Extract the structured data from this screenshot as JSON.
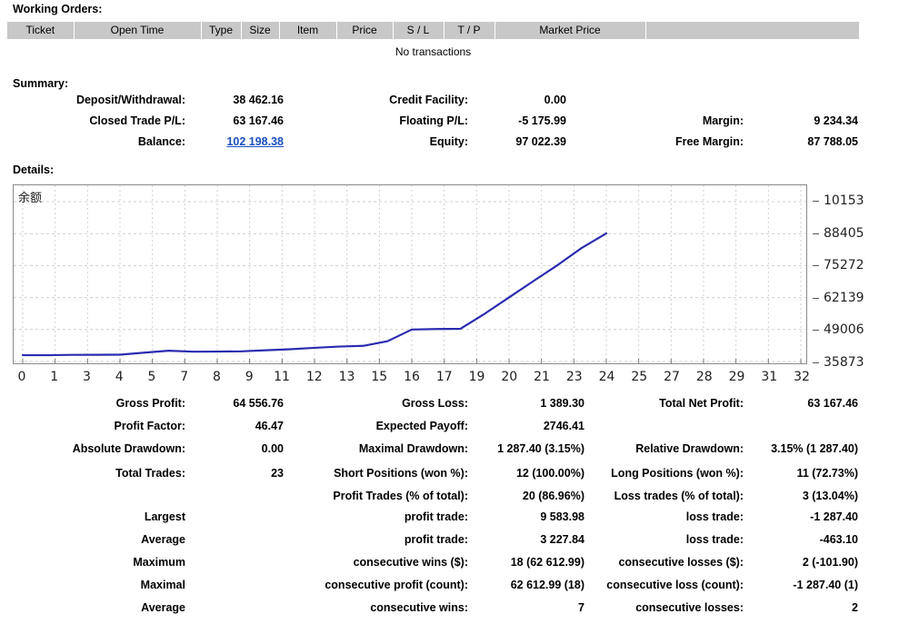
{
  "working_orders": {
    "title": "Working Orders:",
    "columns": [
      "Ticket",
      "Open Time",
      "Type",
      "Size",
      "Item",
      "Price",
      "S / L",
      "T / P",
      "Market Price",
      ""
    ],
    "empty_message": "No transactions"
  },
  "summary": {
    "title": "Summary:",
    "rows": [
      {
        "label1": "Deposit/Withdrawal:",
        "value1": "38 462.16",
        "label2": "Credit Facility:",
        "value2": "0.00",
        "label3": "",
        "value3": ""
      },
      {
        "label1": "Closed Trade P/L:",
        "value1": "63 167.46",
        "label2": "Floating P/L:",
        "value2": "-5 175.99",
        "label3": "Margin:",
        "value3": "9 234.34"
      },
      {
        "label1": "Balance:",
        "value1": "102 198.38",
        "label2": "Equity:",
        "value2": "97 022.39",
        "label3": "Free Margin:",
        "value3": "87 788.05"
      }
    ]
  },
  "details": {
    "title": "Details:"
  },
  "chart_data": {
    "type": "line",
    "title": "",
    "legend": "余额",
    "legend_position": "top-left",
    "xlabel": "",
    "ylabel": "",
    "grid": true,
    "line_color": "#2b2bb0",
    "x_tick_labels": [
      "0",
      "1",
      "3",
      "4",
      "5",
      "7",
      "8",
      "9",
      "11",
      "12",
      "13",
      "15",
      "16",
      "17",
      "19",
      "20",
      "21",
      "23",
      "24",
      "25",
      "27",
      "28",
      "29",
      "31",
      "32"
    ],
    "y_tick_labels": [
      "10153",
      "88405",
      "75272",
      "62139",
      "49006",
      "35873"
    ],
    "ylim": [
      35873,
      101538
    ],
    "xlim": [
      0,
      32
    ],
    "series": [
      {
        "name": "余额",
        "x": [
          0,
          1,
          2,
          3,
          4,
          5,
          6,
          7,
          8,
          9,
          10,
          11,
          12,
          13,
          14,
          15,
          16,
          17,
          18,
          19,
          20,
          21,
          22,
          23,
          24
        ],
        "values": [
          38462,
          38462,
          38600,
          38620,
          38680,
          39500,
          40300,
          39900,
          39950,
          40050,
          40500,
          40900,
          41500,
          42000,
          42300,
          44200,
          49000,
          49200,
          49300,
          55500,
          62200,
          68900,
          75500,
          82600,
          88500
        ]
      }
    ]
  },
  "stats_main": [
    {
      "label1": "Gross Profit:",
      "value1": "64 556.76",
      "label2": "Gross Loss:",
      "value2": "1 389.30",
      "label3": "Total Net Profit:",
      "value3": "63 167.46"
    },
    {
      "label1": "Profit Factor:",
      "value1": "46.47",
      "label2": "Expected Payoff:",
      "value2": "2746.41",
      "label3": "",
      "value3": ""
    },
    {
      "label1": "Absolute Drawdown:",
      "value1": "0.00",
      "label2": "Maximal Drawdown:",
      "value2": "1 287.40 (3.15%)",
      "label3": "Relative Drawdown:",
      "value3": "3.15% (1 287.40)"
    }
  ],
  "stats_trades": [
    {
      "label1": "Total Trades:",
      "value1": "23",
      "label2": "Short Positions (won %):",
      "value2": "12 (100.00%)",
      "label3": "Long Positions (won %):",
      "value3": "11 (72.73%)"
    },
    {
      "label1": "",
      "value1": "",
      "label2": "Profit Trades (% of total):",
      "value2": "20 (86.96%)",
      "label3": "Loss trades (% of total):",
      "value3": "3 (13.04%)"
    }
  ],
  "stats_extremes": [
    {
      "c1": "Largest",
      "c2": "profit trade:",
      "c3": "9 583.98",
      "c4": "loss trade:",
      "c5": "-1 287.40"
    },
    {
      "c1": "Average",
      "c2": "profit trade:",
      "c3": "3 227.84",
      "c4": "loss trade:",
      "c5": "-463.10"
    },
    {
      "c1": "Maximum",
      "c2": "consecutive wins ($):",
      "c3": "18 (62 612.99)",
      "c4": "consecutive losses ($):",
      "c5": "2 (-101.90)"
    },
    {
      "c1": "Maximal",
      "c2": "consecutive profit (count):",
      "c3": "62 612.99 (18)",
      "c4": "consecutive loss (count):",
      "c5": "-1 287.40 (1)"
    },
    {
      "c1": "Average",
      "c2": "consecutive wins:",
      "c3": "7",
      "c4": "consecutive losses:",
      "c5": "2"
    }
  ],
  "colors": {
    "header_bg": "#c8c8c8",
    "link": "#1a4fbf",
    "chart_line": "#2b2bb0",
    "chart_border": "#8a8a8a"
  }
}
